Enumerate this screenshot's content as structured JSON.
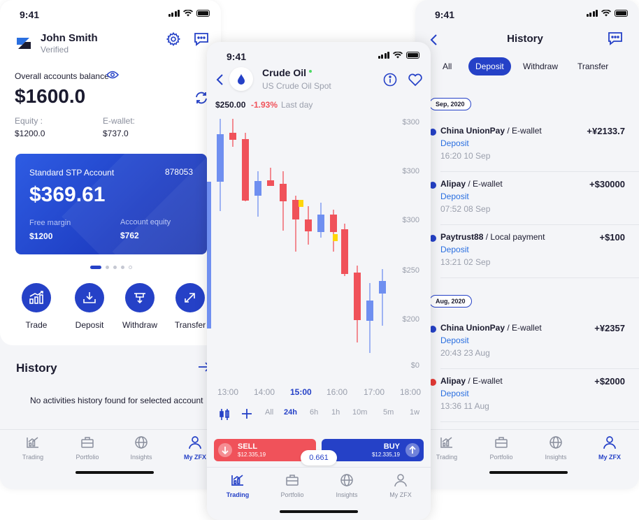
{
  "status": {
    "time": "9:41"
  },
  "left": {
    "user_name": "John Smith",
    "user_status": "Verified",
    "balance_label": "Overall accounts balance",
    "balance_value": "$1600.0",
    "equity_label": "Equity :",
    "equity_value": "$1200.0",
    "ewallet_label": "E-wallet:",
    "ewallet_value": "$737.0",
    "card": {
      "name": "Standard STP Account",
      "number": "878053",
      "amount": "$369.61",
      "free_margin_label": "Free margin",
      "free_margin_value": "$1200",
      "equity_label": "Account equity",
      "equity_value": "$762"
    },
    "actions": [
      "Trade",
      "Deposit",
      "Withdraw",
      "Transfer"
    ],
    "history_title": "History",
    "history_empty": "No activities history found for selected account"
  },
  "tabs": [
    "Trading",
    "Portfolio",
    "Insights",
    "My ZFX"
  ],
  "center": {
    "instrument": "Crude Oil",
    "instrument_sub": "US Crude Oil Spot",
    "price": "$250.00",
    "change": "-1.93%",
    "period": "Last day",
    "y_labels": [
      "$300",
      "$300",
      "$300",
      "$250",
      "$200",
      "$0"
    ],
    "x_labels": [
      "13:00",
      "14:00",
      "15:00",
      "16:00",
      "17:00",
      "18:00"
    ],
    "active_x": "15:00",
    "timeframes": [
      "All",
      "24h",
      "6h",
      "1h",
      "10m",
      "5m",
      "1w"
    ],
    "active_timeframe": "24h",
    "sell_label": "SELL",
    "sell_price": "$12.335,19",
    "buy_label": "BUY",
    "buy_price": "$12.335,19",
    "spread": "0.661"
  },
  "right": {
    "title": "History",
    "filters": [
      "All",
      "Deposit",
      "Withdraw",
      "Transfer"
    ],
    "active_filter": "Deposit",
    "groups": [
      {
        "date": "Sep, 2020",
        "items": [
          {
            "name": "China UnionPay",
            "method": "/ E-wallet",
            "type": "Deposit",
            "time": "16:20",
            "date": "10 Sep",
            "amount": "+¥2133.7",
            "status": "ok"
          },
          {
            "name": "Alipay",
            "method": "/ E-wallet",
            "type": "Deposit",
            "time": "07:52",
            "date": "08 Sep",
            "amount": "+$30000",
            "status": "ok"
          },
          {
            "name": "Paytrust88",
            "method": "/ Local payment",
            "type": "Deposit",
            "time": "13:21",
            "date": "02 Sep",
            "amount": "+$100",
            "status": "ok"
          }
        ]
      },
      {
        "date": "Aug, 2020",
        "items": [
          {
            "name": "China UnionPay",
            "method": "/ E-wallet",
            "type": "Deposit",
            "time": "20:43",
            "date": "23 Aug",
            "amount": "+¥2357",
            "status": "ok"
          },
          {
            "name": "Alipay",
            "method": "/ E-wallet",
            "type": "Deposit",
            "time": "13:36",
            "date": "11 Aug",
            "amount": "+$2000",
            "status": "failed"
          }
        ]
      }
    ]
  },
  "colors": {
    "primary": "#2541c7",
    "sell": "#f0525a",
    "down_candle": "#f0525a",
    "up_candle": "#6f8ff0",
    "highlight": "#ffd60a",
    "link": "#2a6fe0"
  }
}
